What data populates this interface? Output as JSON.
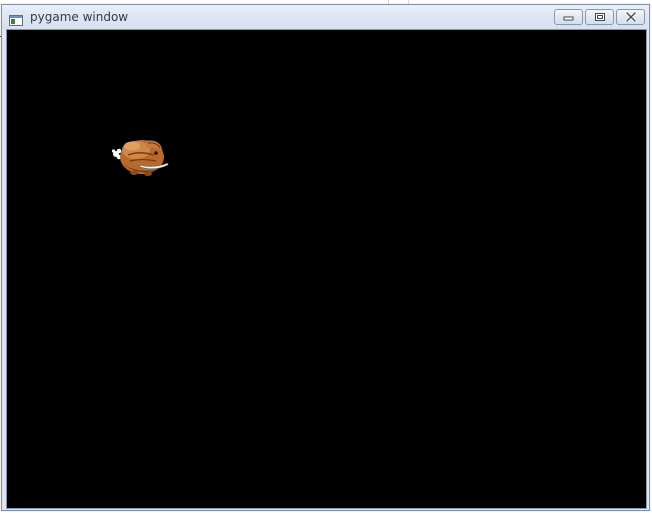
{
  "window": {
    "title": "pygame window",
    "client_background": "#000000",
    "controls": [
      {
        "name": "minimize-button",
        "icon": "minimize-icon"
      },
      {
        "name": "maximize-button",
        "icon": "maximize-icon"
      },
      {
        "name": "close-button",
        "icon": "close-icon"
      }
    ]
  },
  "game": {
    "sprite": {
      "icon": "duck-creature-sprite",
      "colors": {
        "body": "#b86a2c",
        "highlight": "#e0a060",
        "shadow": "#6e3a12",
        "accent": "#ffffff"
      }
    }
  }
}
